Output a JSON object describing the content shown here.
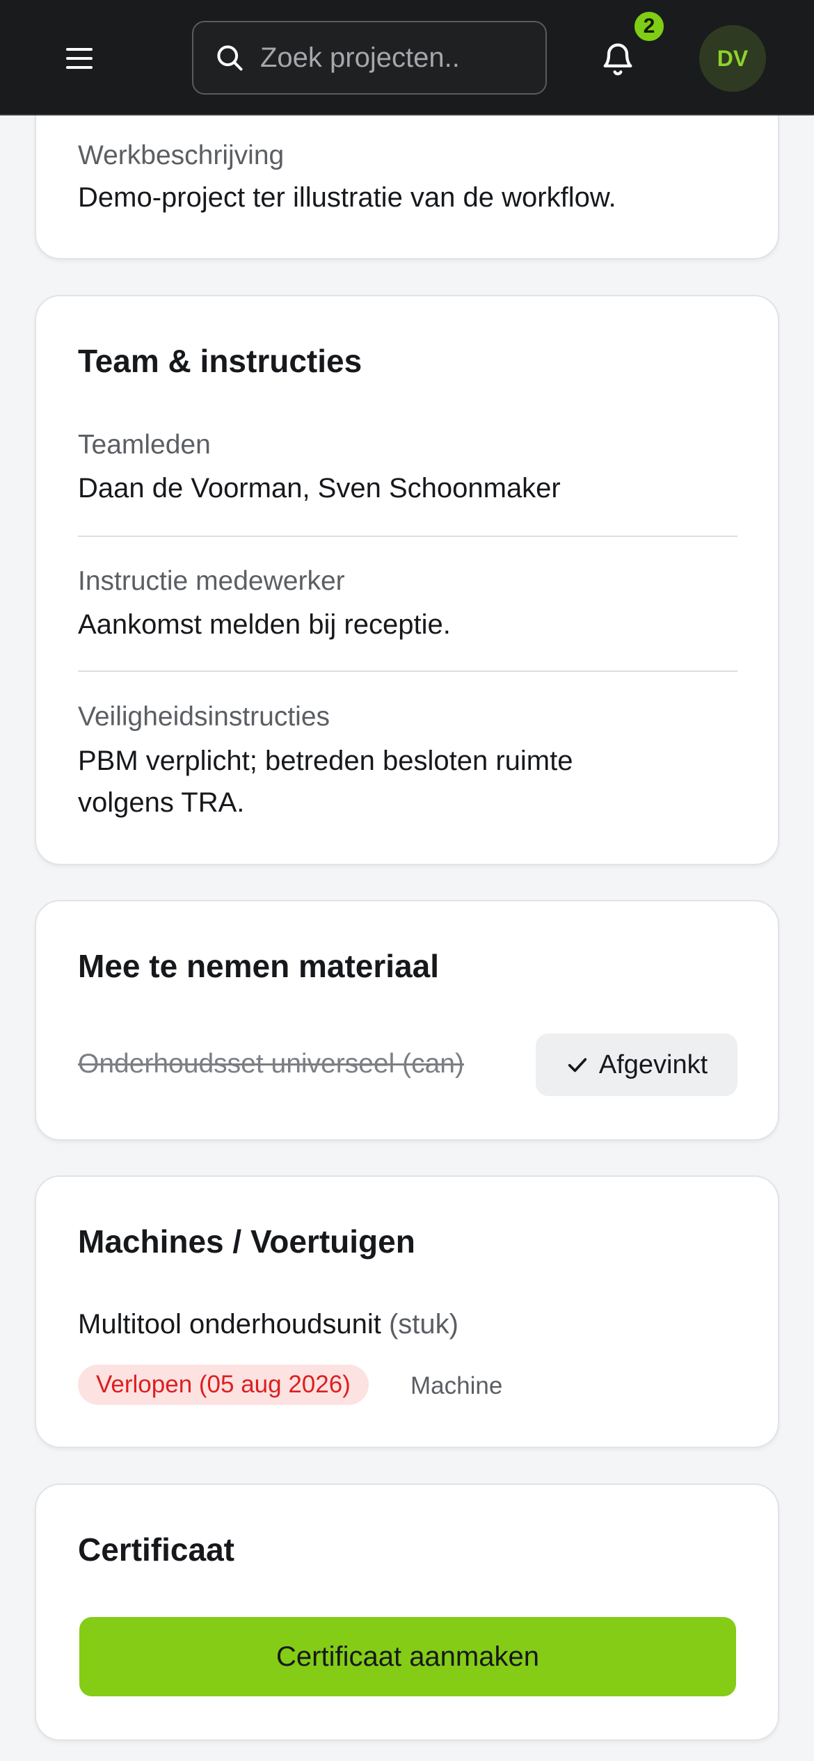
{
  "header": {
    "search_placeholder": "Zoek projecten...",
    "notification_count": "2",
    "avatar_initials": "DV"
  },
  "work": {
    "label": "Werkbeschrijving",
    "value": "Demo-project ter illustratie van de workflow."
  },
  "team": {
    "title": "Team & instructies",
    "members_label": "Teamleden",
    "members_value": "Daan de Voorman, Sven Schoonmaker",
    "instruction_label": "Instructie medewerker",
    "instruction_value": "Aankomst melden bij receptie.",
    "safety_label": "Veiligheidsinstructies",
    "safety_value": "PBM verplicht; betreden besloten ruimte volgens TRA."
  },
  "materials": {
    "title": "Mee te nemen materiaal",
    "item_label": "Onderhoudsset universeel (can)",
    "checked_label": "Afgevinkt"
  },
  "machines": {
    "title": "Machines / Voertuigen",
    "item_name": "Multitool onderhoudsunit",
    "item_unit": "(stuk)",
    "status_label": "Verlopen (05 aug 2026)",
    "type_label": "Machine"
  },
  "certificate": {
    "title": "Certificaat",
    "button_label": "Certificaat aanmaken"
  },
  "colors": {
    "accent": "#84cc16",
    "topbar": "#1a1b1c",
    "expired_text": "#dc1f1f",
    "expired_bg": "#fde2e2"
  }
}
